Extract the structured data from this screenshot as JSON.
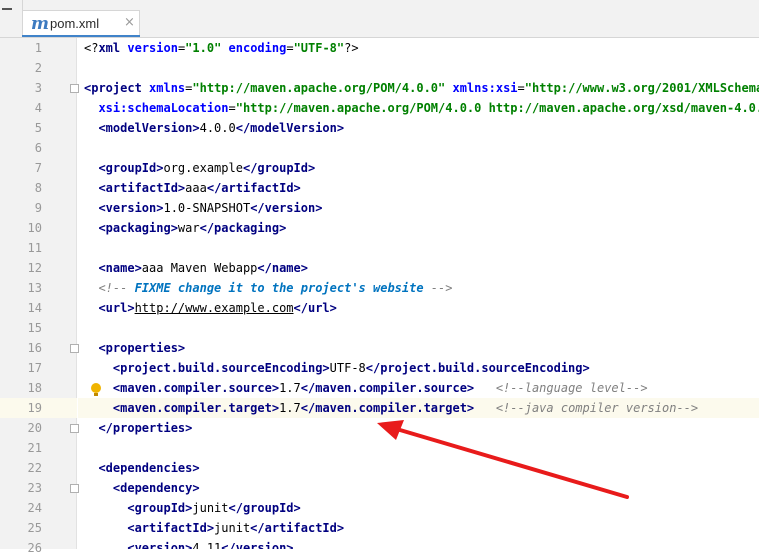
{
  "tab": {
    "label": "pom.xml",
    "file_icon": "maven-m-icon",
    "close_glyph": "×"
  },
  "colors": {
    "tag": "#000080",
    "attr_name": "#0000ff",
    "attr_value": "#008000",
    "comment": "#808080",
    "doc_comment": "#0073bf",
    "arrow": "#e81b1b"
  },
  "line_numbers": [
    "1",
    "2",
    "3",
    "4",
    "5",
    "6",
    "7",
    "8",
    "9",
    "10",
    "11",
    "12",
    "13",
    "14",
    "15",
    "16",
    "17",
    "18",
    "19",
    "20",
    "21",
    "22",
    "23",
    "24",
    "25",
    "26"
  ],
  "code": {
    "l1": {
      "a": "<?",
      "b": "xml",
      "c": " version",
      "d": "=",
      "e": "\"1.0\"",
      "f": " encoding",
      "g": "=",
      "h": "\"UTF-8\"",
      "i": "?>"
    },
    "l3": {
      "a": "<project",
      "b": " xmlns",
      "c": "=",
      "d": "\"http://maven.apache.org/POM/4.0.0\"",
      "e": " xmlns:xsi",
      "f": "=",
      "g": "\"http://www.w3.org/2001/XMLSchema-in"
    },
    "l4": {
      "a": "  xsi:schemaLocation",
      "b": "=",
      "c": "\"http://maven.apache.org/POM/4.0.0 http://maven.apache.org/xsd/maven-4.0.0.x"
    },
    "l5": {
      "open": "  <modelVersion>",
      "val": "4.0.0",
      "close": "</modelVersion>"
    },
    "l7": {
      "open": "  <groupId>",
      "val": "org.example",
      "close": "</groupId>"
    },
    "l8": {
      "open": "  <artifactId>",
      "val": "aaa",
      "close": "</artifactId>"
    },
    "l9": {
      "open": "  <version>",
      "val": "1.0-SNAPSHOT",
      "close": "</version>"
    },
    "l10": {
      "open": "  <packaging>",
      "val": "war",
      "close": "</packaging>"
    },
    "l12": {
      "open": "  <name>",
      "val": "aaa Maven Webapp",
      "close": "</name>"
    },
    "l13": {
      "a": "  <!-- ",
      "b": "FIXME change it to the project's website",
      "c": " -->"
    },
    "l14": {
      "open": "  <url>",
      "val": "http://www.example.com",
      "close": "</url>"
    },
    "l16": {
      "open": "  <properties>"
    },
    "l17": {
      "open": "    <project.build.sourceEncoding>",
      "val": "UTF-8",
      "close": "</project.build.sourceEncoding>"
    },
    "l18": {
      "open": "    <maven.compiler.source>",
      "val": "1.7",
      "close": "</maven.compiler.source>",
      "comment": "   <!--language level-->"
    },
    "l19": {
      "open": "    <maven.compiler.target>",
      "val": "1.7",
      "close": "</maven.compiler.target>",
      "comment": "   <!--java compiler version-->"
    },
    "l20": {
      "close": "  </properties>"
    },
    "l22": {
      "open": "  <dependencies>"
    },
    "l23": {
      "open": "    <dependency>"
    },
    "l24": {
      "open": "      <groupId>",
      "val": "junit",
      "close": "</groupId>"
    },
    "l25": {
      "open": "      <artifactId>",
      "val": "junit",
      "close": "</artifactId>"
    },
    "l26": {
      "open": "      <version>",
      "val": "4.11",
      "close": "</version>"
    }
  }
}
